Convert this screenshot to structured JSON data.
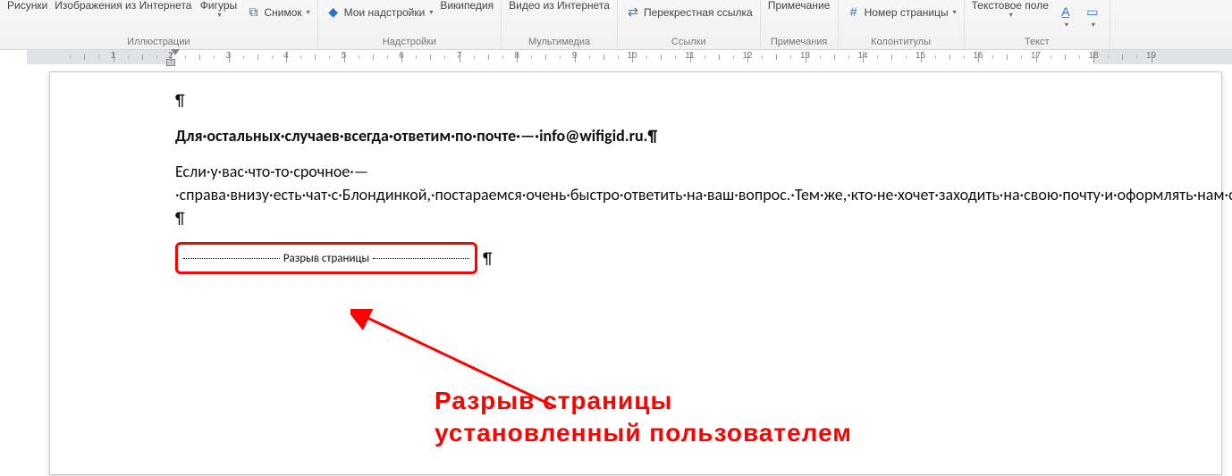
{
  "ribbon": {
    "groups": {
      "illustrations": {
        "label": "Иллюстрации",
        "pictures": "Рисунки",
        "webimg": "Изображения из Интернета",
        "shapes": "Фигуры",
        "screenshot": "Снимок"
      },
      "addins": {
        "label": "Надстройки",
        "myaddins": "Мои надстройки",
        "wikipedia": "Википедия"
      },
      "media": {
        "label": "Мультимедиа",
        "video": "Видео из Интернета"
      },
      "links": {
        "label": "Ссылки",
        "xref": "Перекрестная ссылка"
      },
      "comments": {
        "label": "Примечания",
        "comment": "Примечание"
      },
      "headerfooter": {
        "label": "Колонтитулы",
        "pagenum": "Номер страницы"
      },
      "text": {
        "label": "Текст",
        "textbox": "Текстовое поле"
      }
    }
  },
  "document": {
    "paragraph_mark": "¶",
    "bold_line": "Для·остальных·случаев·всегда·ответим·по·почте·—·info@wifigid.ru.",
    "body": "Если·у·вас·что-то·срочное·—·справа·внизу·есть·чат·с·Блондинкой,·постараемся·очень·быстро·ответить·на·ваш·вопрос.·Тем·же,·кто·не·хочет·заходить·на·свою·почту·и·оформлять·нам·самое·душевное·письмо·или·просто·не·любит·блондинок,·предлагаем·форму·быстрой·связи.·Через·нее·мы·тоже·получим·ваше·сообщение·и·обязательно·ответим!",
    "page_break_label": "Разрыв страницы"
  },
  "annotation": {
    "line1": "Разрыв страницы",
    "line2": "установленный пользователем"
  },
  "ruler": {
    "start": 2,
    "end": 19
  }
}
